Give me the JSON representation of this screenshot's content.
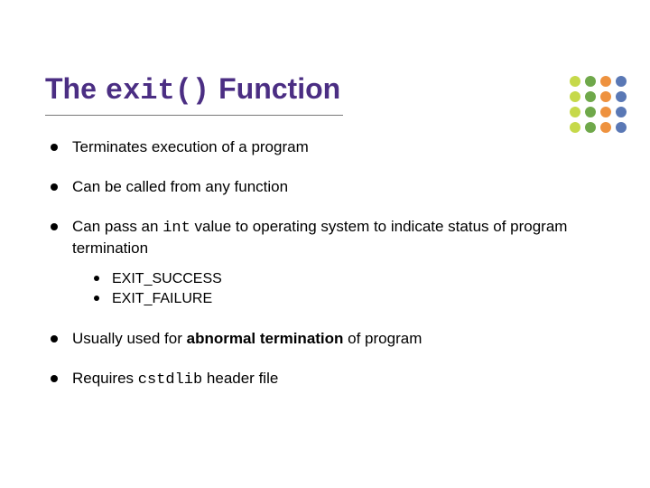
{
  "title": {
    "prefix": "The",
    "code": "exit()",
    "suffix": "Function"
  },
  "bullets": [
    {
      "text": "Terminates execution of a program"
    },
    {
      "text": "Can be called from any function"
    },
    {
      "pre": "Can pass an ",
      "code": "int",
      "post": " value to operating system to indicate status of program termination",
      "sub": [
        "EXIT_SUCCESS",
        "EXIT_FAILURE"
      ]
    },
    {
      "pre": "Usually used for ",
      "bold": "abnormal termination",
      "post": " of program"
    },
    {
      "pre": "Requires ",
      "code": "cstdlib",
      "post": " header file"
    }
  ],
  "dot_colors": [
    "#c6d94a",
    "#6fa84a",
    "#ee923f",
    "#5a78b5",
    "#c6d94a",
    "#6fa84a",
    "#ee923f",
    "#5a78b5",
    "#c6d94a",
    "#6fa84a",
    "#ee923f",
    "#5a78b5",
    "#c6d94a",
    "#6fa84a",
    "#ee923f",
    "#5a78b5"
  ]
}
